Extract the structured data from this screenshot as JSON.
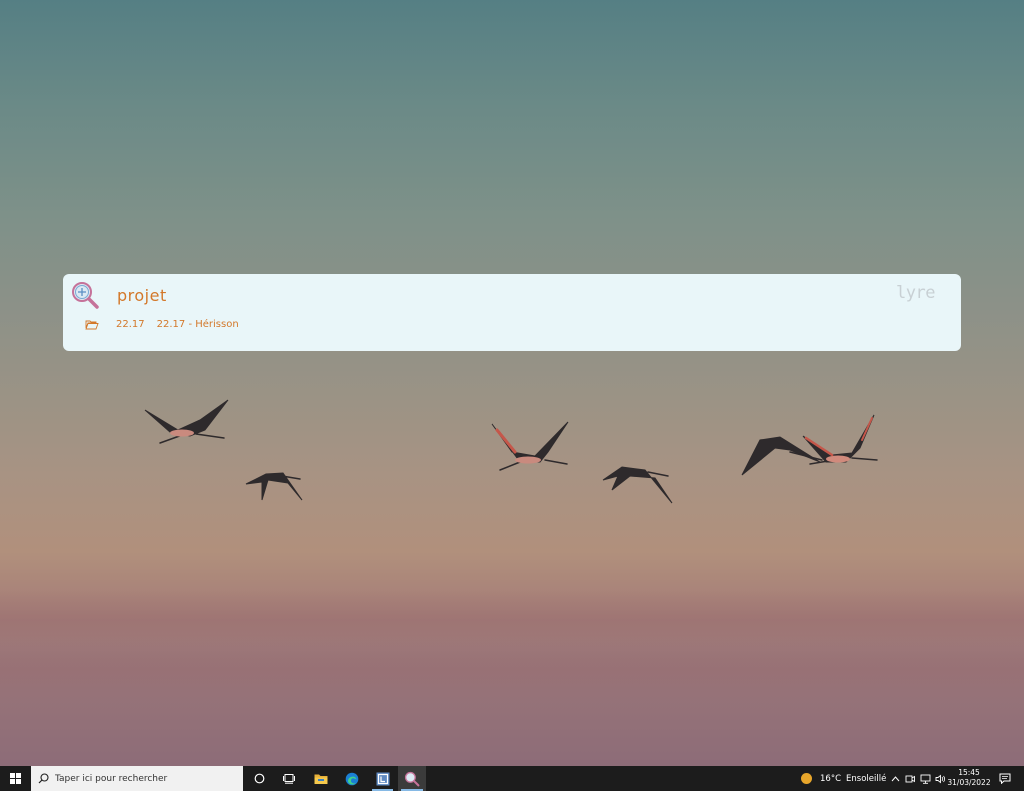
{
  "launcher": {
    "query": "projet",
    "brand": "lyre",
    "result": {
      "icon": "folder-open-icon",
      "name": "22.17",
      "path": "22.17 - Hérisson"
    }
  },
  "taskbar": {
    "search_placeholder": "Taper ici pour rechercher",
    "apps": [
      "cortana-icon",
      "task-view-icon",
      "file-explorer-icon",
      "edge-icon",
      "app-icon",
      "launcher-search-icon"
    ],
    "weather": {
      "temperature": "16°C",
      "condition": "Ensoleillé"
    },
    "clock": {
      "time": "15:45",
      "date": "31/03/2022"
    }
  },
  "colors": {
    "launcher_bg": "#e9f6f9",
    "accent": "#d3782a",
    "taskbar_bg": "#1c1c1c",
    "active_indicator": "#86b9e5"
  }
}
